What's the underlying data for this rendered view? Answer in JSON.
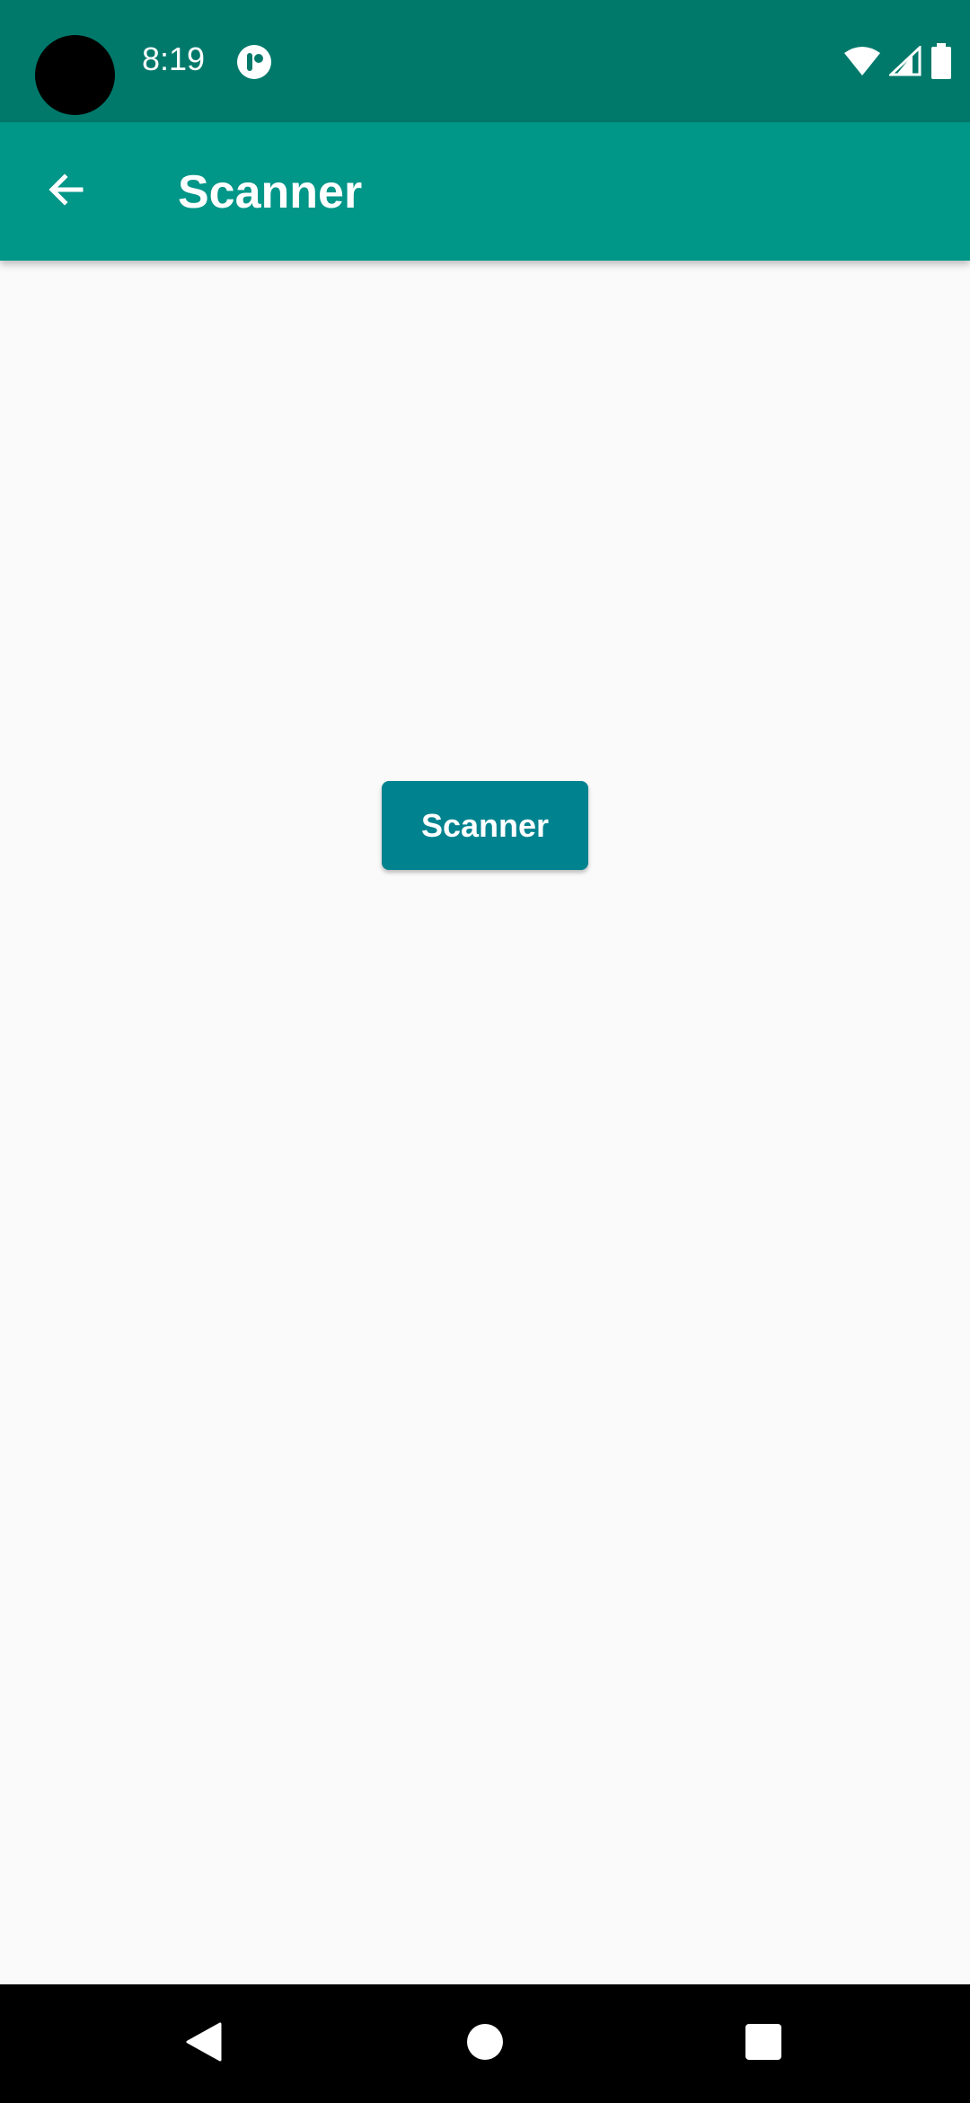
{
  "status_bar": {
    "time": "8:19",
    "app_icon": "notification-app-icon",
    "icons": [
      "wifi-icon",
      "cell-signal-icon",
      "battery-icon"
    ],
    "background": "#00796b"
  },
  "app_bar": {
    "title": "Scanner",
    "back_icon": "arrow-back-icon",
    "background": "#009688"
  },
  "main": {
    "scanner_button_label": "Scanner",
    "button_color": "#00838f",
    "background": "#fafafa"
  },
  "nav_bar": {
    "buttons": [
      "nav-back-icon",
      "nav-home-icon",
      "nav-recents-icon"
    ],
    "background": "#000000"
  }
}
